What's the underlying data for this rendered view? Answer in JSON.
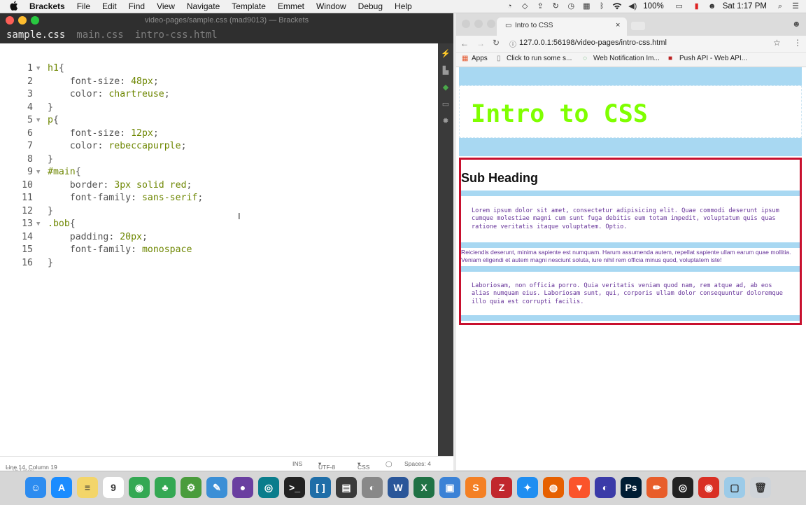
{
  "menubar": {
    "app_name": "Brackets",
    "items": [
      "File",
      "Edit",
      "Find",
      "View",
      "Navigate",
      "Template",
      "Emmet",
      "Window",
      "Debug",
      "Help"
    ],
    "battery": "100%",
    "clock": "Sat 1:17 PM"
  },
  "editor": {
    "title": "video-pages/sample.css (mad9013) — Brackets",
    "tabs": [
      "sample.css",
      "main.css",
      "intro-css.html"
    ],
    "lines": [
      {
        "n": "1",
        "fold": true,
        "parts": [
          [
            "sel",
            "h1"
          ],
          [
            "prop",
            "{"
          ]
        ]
      },
      {
        "n": "2",
        "fold": false,
        "parts": [
          [
            "prop",
            "    font-size: "
          ],
          [
            "num",
            "48px"
          ],
          [
            "prop",
            ";"
          ]
        ]
      },
      {
        "n": "3",
        "fold": false,
        "parts": [
          [
            "prop",
            "    color: "
          ],
          [
            "val",
            "chartreuse"
          ],
          [
            "prop",
            ";"
          ]
        ]
      },
      {
        "n": "4",
        "fold": false,
        "parts": [
          [
            "prop",
            "}"
          ]
        ]
      },
      {
        "n": "5",
        "fold": true,
        "parts": [
          [
            "sel",
            "p"
          ],
          [
            "prop",
            "{"
          ]
        ]
      },
      {
        "n": "6",
        "fold": false,
        "parts": [
          [
            "prop",
            "    font-size: "
          ],
          [
            "num",
            "12px"
          ],
          [
            "prop",
            ";"
          ]
        ]
      },
      {
        "n": "7",
        "fold": false,
        "parts": [
          [
            "prop",
            "    color: "
          ],
          [
            "val",
            "rebeccapurple"
          ],
          [
            "prop",
            ";"
          ]
        ]
      },
      {
        "n": "8",
        "fold": false,
        "parts": [
          [
            "prop",
            "}"
          ]
        ]
      },
      {
        "n": "9",
        "fold": true,
        "parts": [
          [
            "sel",
            "#main"
          ],
          [
            "prop",
            "{"
          ]
        ]
      },
      {
        "n": "10",
        "fold": false,
        "parts": [
          [
            "prop",
            "    border: "
          ],
          [
            "num",
            "3px"
          ],
          [
            "val",
            " solid red"
          ],
          [
            "prop",
            ";"
          ]
        ]
      },
      {
        "n": "11",
        "fold": false,
        "parts": [
          [
            "prop",
            "    font-family: "
          ],
          [
            "val",
            "sans-serif"
          ],
          [
            "prop",
            ";"
          ]
        ]
      },
      {
        "n": "12",
        "fold": false,
        "parts": [
          [
            "prop",
            "}"
          ]
        ]
      },
      {
        "n": "13",
        "fold": true,
        "parts": [
          [
            "sel",
            ".bob"
          ],
          [
            "prop",
            "{"
          ]
        ]
      },
      {
        "n": "14",
        "fold": false,
        "parts": [
          [
            "prop",
            "    padding: "
          ],
          [
            "num",
            "20px"
          ],
          [
            "prop",
            ";"
          ]
        ]
      },
      {
        "n": "15",
        "fold": false,
        "parts": [
          [
            "prop",
            "    font-family: "
          ],
          [
            "val",
            "monospace"
          ]
        ]
      },
      {
        "n": "16",
        "fold": false,
        "parts": [
          [
            "prop",
            "}"
          ]
        ]
      }
    ],
    "status": {
      "position": "Line 14, Column 19",
      "line_count": "16 Lines",
      "mode": "INS",
      "encoding": "UTF-8",
      "language": "CSS",
      "spaces": "Spaces: 4"
    }
  },
  "browser": {
    "tab_title": "Intro to CSS",
    "url": "127.0.0.1:56198/video-pages/intro-css.html",
    "bookmarks": [
      "Apps",
      "Click to run some s...",
      "Web Notification Im...",
      "Push API - Web API..."
    ],
    "page": {
      "h1": "Intro to CSS",
      "subheading": "Sub Heading",
      "para1": "Lorem ipsum dolor sit amet, consectetur adipisicing elit. Quae commodi deserunt ipsum cumque molestiae magni cum sunt fuga debitis eum totam impedit, voluptatum quis quas ratione veritatis itaque voluptatem. Optio.",
      "para2": "Reiciendis deserunt, minima sapiente est numquam. Harum assumenda autem, repellat sapiente ullam earum quae mollitia. Veniam eligendi et autem magni nesciunt soluta, iure nihil rem officia minus quod, voluptatem iste!",
      "para3": "Laboriosam, non officia porro. Quia veritatis veniam quod nam, rem atque ad, ab eos alias numquam eius. Laboriosam sunt, qui, corporis ullam dolor consequuntur doloremque illo quia est corrupti facilis."
    }
  },
  "dock": {
    "apps": [
      {
        "name": "finder",
        "color": "#2d8cf0",
        "glyph": "☺"
      },
      {
        "name": "app-store",
        "color": "#1a8cff",
        "glyph": "A"
      },
      {
        "name": "notes",
        "color": "#f3d56a",
        "glyph": "≡"
      },
      {
        "name": "calendar",
        "color": "#ffffff",
        "glyph": "9"
      },
      {
        "name": "chrome",
        "color": "#34a853",
        "glyph": "◉"
      },
      {
        "name": "brackets-leaf",
        "color": "#34a853",
        "glyph": "♣"
      },
      {
        "name": "gitbox",
        "color": "#4a9c3c",
        "glyph": "⚙"
      },
      {
        "name": "xcode",
        "color": "#3b8fd6",
        "glyph": "✎"
      },
      {
        "name": "github",
        "color": "#6a3fa0",
        "glyph": "●"
      },
      {
        "name": "sourcetree",
        "color": "#0a7d8c",
        "glyph": "◎"
      },
      {
        "name": "terminal",
        "color": "#222222",
        "glyph": ">_"
      },
      {
        "name": "brackets",
        "color": "#1f6ea8",
        "glyph": "[ ]"
      },
      {
        "name": "notebook",
        "color": "#3a3a3a",
        "glyph": "▤"
      },
      {
        "name": "sequel",
        "color": "#888888",
        "glyph": "◐"
      },
      {
        "name": "word",
        "color": "#2a5699",
        "glyph": "W"
      },
      {
        "name": "excel",
        "color": "#207245",
        "glyph": "X"
      },
      {
        "name": "screen-share",
        "color": "#3b82d6",
        "glyph": "▣"
      },
      {
        "name": "sublime",
        "color": "#f48024",
        "glyph": "S"
      },
      {
        "name": "filezilla",
        "color": "#c1272d",
        "glyph": "Z"
      },
      {
        "name": "safari",
        "color": "#1f8ef1",
        "glyph": "✦"
      },
      {
        "name": "firefox",
        "color": "#e66000",
        "glyph": "◍"
      },
      {
        "name": "brave",
        "color": "#fb542b",
        "glyph": "▼"
      },
      {
        "name": "night-owl",
        "color": "#3b3ba8",
        "glyph": "◐"
      },
      {
        "name": "photoshop",
        "color": "#001d34",
        "glyph": "Ps"
      },
      {
        "name": "pencil",
        "color": "#e85d2a",
        "glyph": "✏"
      },
      {
        "name": "aperture",
        "color": "#222222",
        "glyph": "◎"
      },
      {
        "name": "chrome-canary",
        "color": "#d93025",
        "glyph": "◉"
      },
      {
        "name": "downloads",
        "color": "#9ccbe8",
        "glyph": "▢"
      },
      {
        "name": "trash",
        "color": "#cfd4d9",
        "glyph": "🗑"
      }
    ]
  }
}
